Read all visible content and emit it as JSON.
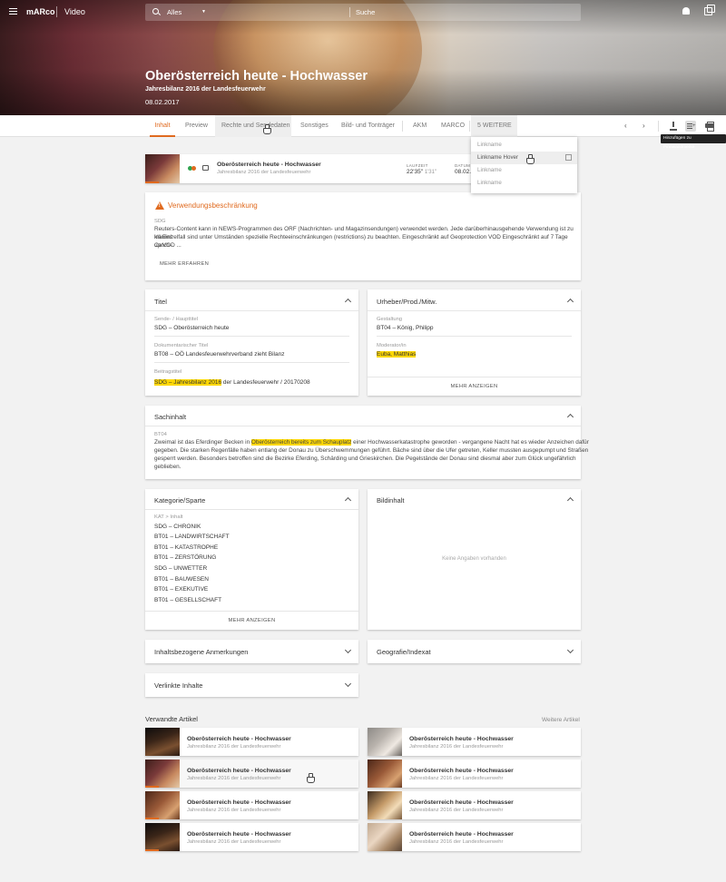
{
  "header": {
    "brand": "mARco",
    "section": "Video",
    "search_scope": "Alles",
    "search_placeholder": "Suche",
    "title": "Oberösterreich heute - Hochwasser",
    "subtitle": "Jahresbilanz 2016 der Landesfeuerwehr",
    "date": "08.02.2017"
  },
  "tabs": [
    "Inhalt",
    "Preview",
    "Rechte und Sendedaten",
    "Sonstiges",
    "Bild- und Tonträger",
    "AKM",
    "MARCO",
    "5 WEITERE ..."
  ],
  "tooltip": "Hinzufügen zu Pinnwandmerke",
  "dropdown": [
    "Linkname",
    "Linkname Hover",
    "Linkname",
    "Linkname"
  ],
  "video": {
    "title": "Oberösterreich heute - Hochwasser",
    "subtitle": "Jahresbilanz 2016 der Landesfeuerwehr",
    "duration_label": "LAUFZEIT",
    "duration": "22'35\"",
    "duration_extra": "1'31\"",
    "date_label": "DATUM",
    "date": "08.02."
  },
  "restriction": {
    "title": "Verwendungsbeschränkung",
    "code": "SDG",
    "text1": "Reuters-Content kann in NEWS-Programmen des ORF (Nachrichten- und Magazinsendungen) verwendet werden. Jede darüberhinausgehende Verwendung ist zu klären!",
    "text2": "Im Einzelfall sind unter Umständen spezielle Rechteeinschränkungen (restrictions) zu beachten. Eingeschränkt auf Geoprotection VOD Eingeschränkt auf 7 Tage Catch-",
    "text3": "up VOD ...",
    "button": "MEHR ERFAHREN"
  },
  "titel": {
    "heading": "Titel",
    "f1_label": "Sende- / Haupttitel",
    "f1_value": "SDG – Oberösterreich heute",
    "f2_label": "Dokumentarischer Titel",
    "f2_value": "BT08 – OÖ Landesfeuerwehrverband zieht Bilanz",
    "f3_label": "Beitragstitel",
    "f3_hl": "SDG – Jahresbilanz 2016",
    "f3_rest": " der Landesfeuerwehr / 20170208"
  },
  "urheber": {
    "heading": "Urheber/Prod./Mitw.",
    "f1_label": "Gestaltung",
    "f1_value": "BT04 – König, Philipp",
    "f2_label": "Moderator/in",
    "f2_value": "Euba, Matthias",
    "button": "MEHR ANZEIGEN"
  },
  "sachinhalt": {
    "heading": "Sachinhalt",
    "code": "BT04",
    "l1a": "Zweimal ist das Eferdinger Becken in ",
    "l1hl": "Oberösterreich bereits zum Schauplatz",
    "l1b": " einer Hochwasserkatastrophe geworden - vergangene Nacht hat es wieder Anzeichen dafür",
    "l2": "gegeben. Die starken Regenfälle haben entlang der Donau zu Überschwemmungen geführt. Bäche sind über die Ufer getreten, Keller mussten ausgepumpt und Straßen",
    "l3": "gesperrt werden. Besonders betroffen sind die Bezirke Eferding, Schärding und Grieskirchen. Die Pegelstände der Donau sind diesmal aber zum Glück ungefährlich",
    "l4": "geblieben."
  },
  "kategorie": {
    "heading": "Kategorie/Sparte",
    "label": "KAT > Inhalt",
    "items": [
      "SDG – CHRONIK",
      "BT01 – LANDWIRTSCHAFT",
      "BT01 – KATASTROPHE",
      "BT01 – ZERSTÖRUNG",
      "SDG – UNWETTER",
      "BT01 – BAUWESEN",
      "BT01 – EXEKUTIVE",
      "BT01 – GESELLSCHAFT"
    ],
    "button": "MEHR ANZEIGEN"
  },
  "bildinhalt": {
    "heading": "Bildinhalt",
    "empty": "Keine Angaben vorhanden"
  },
  "collapsed": {
    "anmerkungen": "Inhaltsbezogene Anmerkungen",
    "geografie": "Geografie/Indexat",
    "verlinkt": "Verlinkte Inhalte"
  },
  "related": {
    "heading": "Verwandte Artikel",
    "more": "Weitere Artikel",
    "items": [
      {
        "title": "Oberösterreich heute - Hochwasser",
        "subtitle": "Jahresbilanz 2016 der Landesfeuerwehr"
      },
      {
        "title": "Oberösterreich heute - Hochwasser",
        "subtitle": "Jahresbilanz 2016 der Landesfeuerwehr"
      },
      {
        "title": "Oberösterreich heute - Hochwasser",
        "subtitle": "Jahresbilanz 2016 der Landesfeuerwehr"
      },
      {
        "title": "Oberösterreich heute - Hochwasser",
        "subtitle": "Jahresbilanz 2016 der Landesfeuerwehr"
      },
      {
        "title": "Oberösterreich heute - Hochwasser",
        "subtitle": "Jahresbilanz 2016 der Landesfeuerwehr"
      },
      {
        "title": "Oberösterreich heute - Hochwasser",
        "subtitle": "Jahresbilanz 2016 der Landesfeuerwehr"
      },
      {
        "title": "Oberösterreich heute - Hochwasser",
        "subtitle": "Jahresbilanz 2016 der Landesfeuerwehr"
      },
      {
        "title": "Oberösterreich heute - Hochwasser",
        "subtitle": "Jahresbilanz 2016 der Landesfeuerwehr"
      }
    ]
  },
  "colors": {
    "accent": "#e06a1f",
    "highlight": "#ffd800",
    "background": "#f2f2f2"
  },
  "icons": [
    "menu-icon",
    "search-icon",
    "bell-icon",
    "apps-icon",
    "chevron-left-icon",
    "chevron-right-icon",
    "download-icon",
    "add-to-pinboard-icon",
    "print-icon",
    "warning-icon",
    "external-link-icon"
  ]
}
